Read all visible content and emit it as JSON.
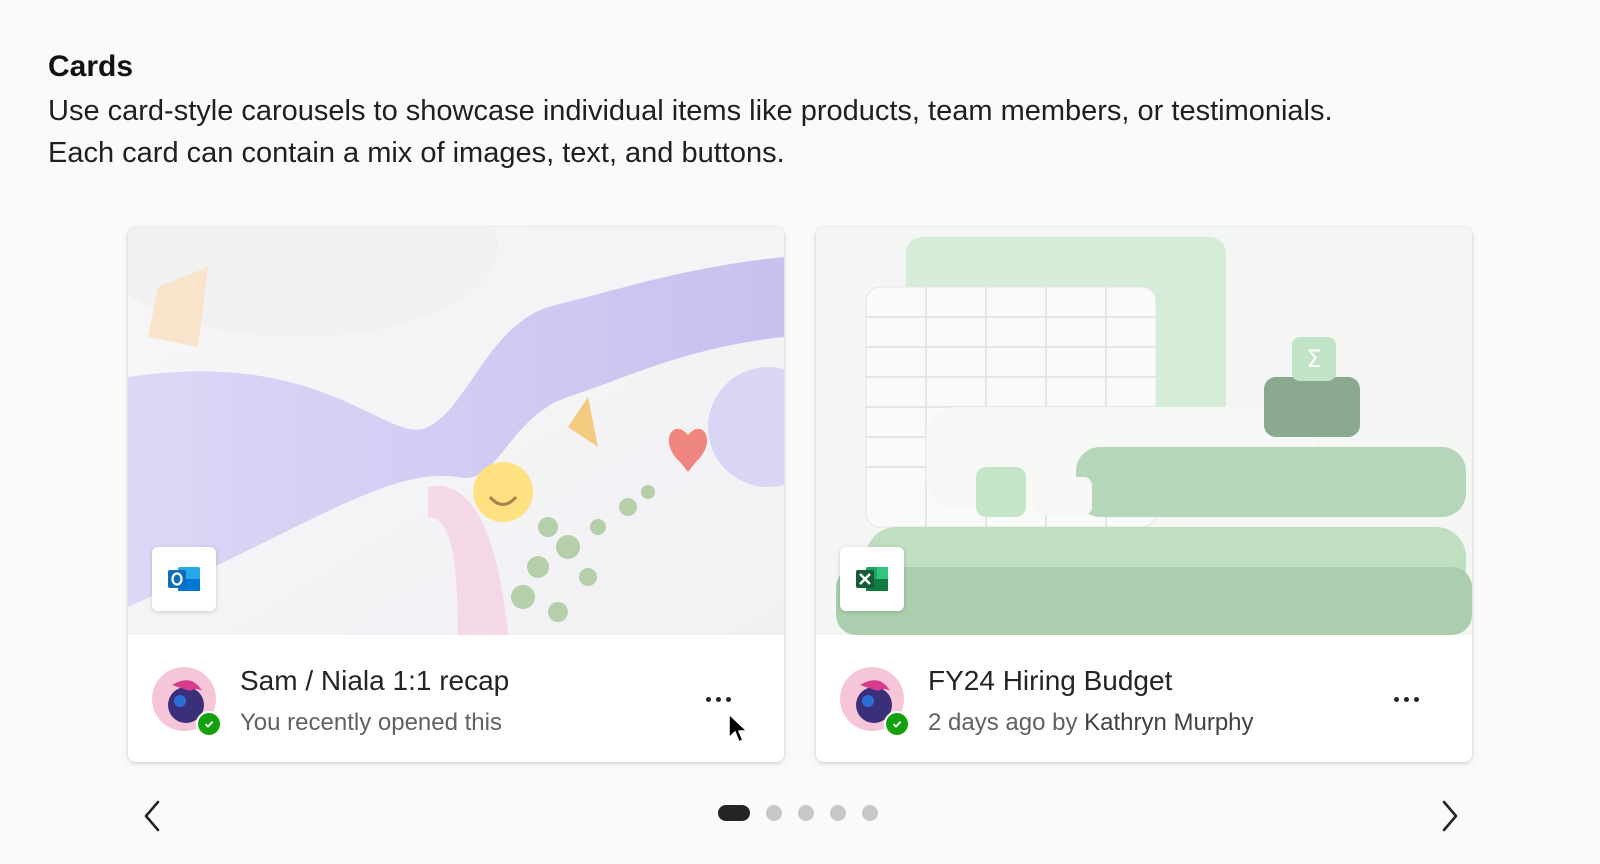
{
  "header": {
    "title": "Cards",
    "description_line1": "Use card-style carousels to showcase individual items like products, team members, or testimonials.",
    "description_line2": "Each card can contain a mix of images, text, and buttons."
  },
  "cards": [
    {
      "app_icon": "outlook-icon",
      "app_letter": "O",
      "title": "Sam / Niala 1:1 recap",
      "subtitle": "You recently opened this",
      "presence": "available",
      "more_icon": "more-horizontal-icon"
    },
    {
      "app_icon": "excel-icon",
      "app_letter": "X",
      "title": "FY24 Hiring Budget",
      "subtitle_prefix": "2 days ago by ",
      "subtitle_author": "Kathryn Murphy",
      "presence": "available",
      "more_icon": "more-horizontal-icon"
    }
  ],
  "carousel": {
    "prev_icon": "chevron-left-icon",
    "next_icon": "chevron-right-icon",
    "page_count": 5,
    "active_page": 1
  },
  "colors": {
    "outlook_blue": "#0f6cbd",
    "excel_green": "#107c41",
    "presence_green": "#13a10e",
    "active_dot": "#242424",
    "inactive_dot": "#c8c8c8"
  }
}
